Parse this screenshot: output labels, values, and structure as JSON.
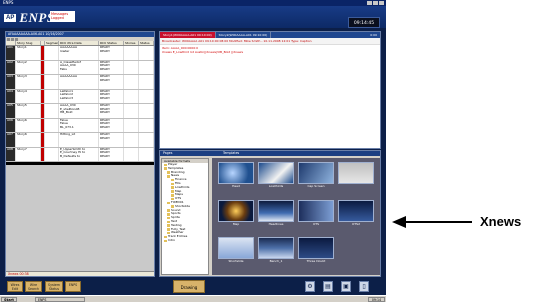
{
  "window": {
    "title": "ENPS"
  },
  "header": {
    "logo_ap": "AP",
    "logo_name": "ENPS",
    "messages": [
      "Messages",
      "Logged"
    ],
    "clock": "09:14:45"
  },
  "rundown": {
    "title": "AFAAAAAAAA-A06-A01 10/16/2007",
    "columns": [
      "",
      "Story Slug",
      "",
      "Segment",
      "RCU Xtra Data",
      "RCU Status",
      "Stories",
      "Status"
    ],
    "rows": [
      {
        "num": "A01",
        "slug": "Story1",
        "xtra": "AAAAAAAA\nlowter",
        "status": "READY\nREADY"
      },
      {
        "num": "A02",
        "slug": "Story2",
        "xtra": "A_Classifiedof\nAAAA_030\nFabs",
        "status": "READY\nREADY\nREADY"
      },
      {
        "num": "A03",
        "slug": "Story3",
        "xtra": "AAAAAAAA",
        "status": "READY\nREADY"
      },
      {
        "num": "A04",
        "slug": "Story4",
        "xtra": "Lalfalor1\nLalfalor2\nLalfalor3",
        "status": "READY\nREADY\nREADY"
      },
      {
        "num": "A05",
        "slug": "Story5",
        "xtra": "AAAA_030\nE_shelltonAB\nHB_Bold",
        "status": "READY\nREADY\nREADY"
      },
      {
        "num": "A06",
        "slug": "Story6",
        "xtra": "Falue\nFalue\nBL_073.1",
        "status": "READY\nREADY\nREADY"
      },
      {
        "num": "A07",
        "slug": "Story6",
        "xtra": "Hitting_LX",
        "status": "READY\nREADY"
      },
      {
        "num": "A08",
        "slug": "Story7",
        "xtra": "E_UpperSmith to\nE_Courtney Hi to\nB_Defaults to",
        "status": "READY\nREADY\nREADY"
      }
    ],
    "status_text": "Xnews 00:38"
  },
  "story": {
    "tabs": [
      "Story1(W00AAAA-A01 09:10:00)",
      "Story2(W00AAAA-A01 09:10:00)"
    ],
    "count": "0:00",
    "meta": "Broadcaster: W00AAAA A01 09:10:00 08:00  Modified: Mike Smith - 10.11.2008 12:01  Type: Caption",
    "body_lines": [
      "Item: AAAA_000:0000:0",
      "Xnews E_Lowthird lot Austin||Xnews|VIB_Bold ||Xnews"
    ]
  },
  "xnews": {
    "tabs": [
      "Pages",
      "Templates"
    ],
    "tree_header": "Available formats",
    "tree": [
      {
        "label": "Player",
        "level": 0
      },
      {
        "label": "Templates",
        "level": 0
      },
      {
        "label": "Branding",
        "level": 1
      },
      {
        "label": "News",
        "level": 1
      },
      {
        "label": "Finance",
        "level": 2
      },
      {
        "label": "Fills",
        "level": 2
      },
      {
        "label": "Lowthirds",
        "level": 2
      },
      {
        "label": "Map",
        "level": 2
      },
      {
        "label": "Maps",
        "level": 2
      },
      {
        "label": "OTS",
        "level": 2
      },
      {
        "label": "FIXED01",
        "level": 1
      },
      {
        "label": "Shortslide",
        "level": 2
      },
      {
        "label": "Sound",
        "level": 1
      },
      {
        "label": "Sports",
        "level": 1
      },
      {
        "label": "Sprite",
        "level": 1
      },
      {
        "label": "Text",
        "level": 1
      },
      {
        "label": "Testing",
        "level": 1
      },
      {
        "label": "Fully_Test",
        "level": 1
      },
      {
        "label": "Weather",
        "level": 1
      },
      {
        "label": "Track Entries",
        "level": 0
      },
      {
        "label": "Intro",
        "level": 0
      }
    ],
    "tiles": [
      "Head",
      "Lowthirds",
      "Cap Screen",
      "",
      "Map",
      "Headlines",
      "OTS",
      "OTS2",
      "Shortslide",
      "Bench_1",
      "Three Doubt"
    ]
  },
  "taskbar_panel": {
    "buttons": [
      "Wires\nEdit",
      "Wire\nSearch",
      "System\nStatus",
      "ENPS"
    ],
    "drawing_label": "Drawing"
  },
  "windows_taskbar": {
    "start_label": "Start",
    "app_label": "ENPS",
    "tray_text": "09:14"
  },
  "callout": {
    "label": "Xnews"
  }
}
